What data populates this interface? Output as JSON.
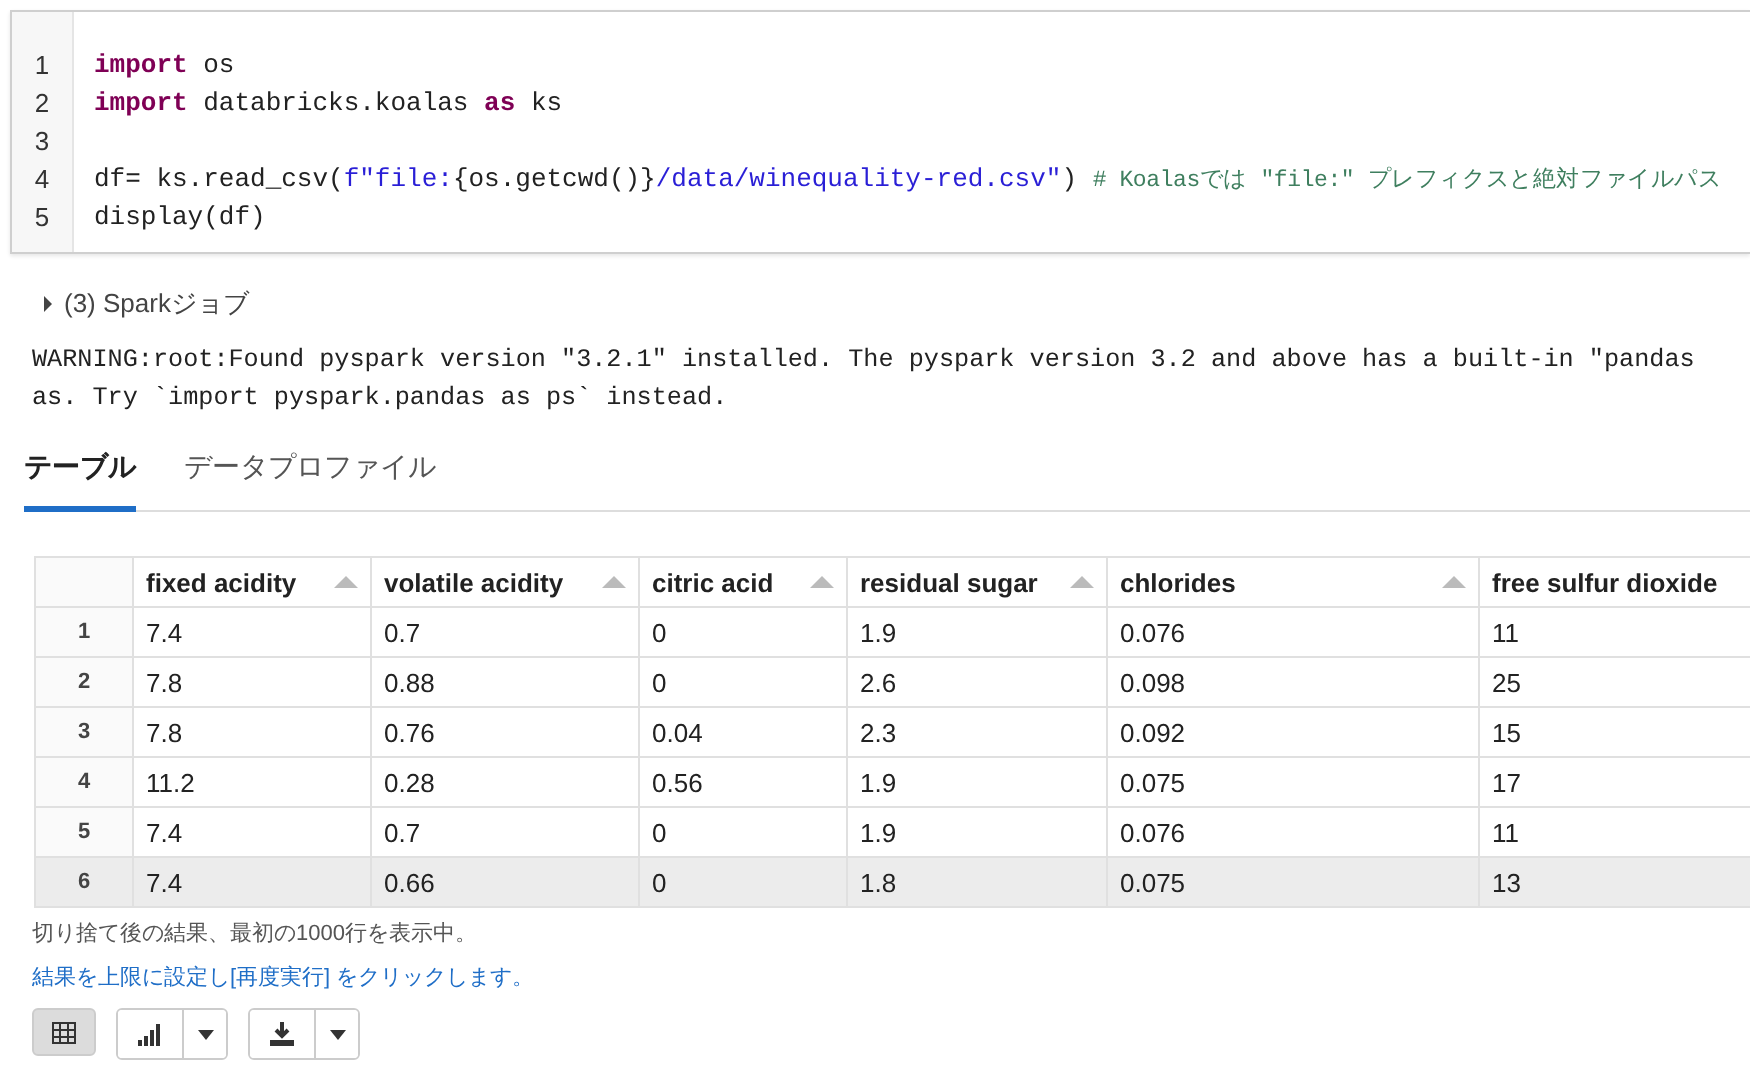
{
  "code_cell": {
    "lines": [
      {
        "number": "1",
        "tokens": [
          {
            "kind": "keyword",
            "text": "import"
          },
          {
            "kind": "plain",
            "text": " os"
          }
        ]
      },
      {
        "number": "2",
        "tokens": [
          {
            "kind": "keyword",
            "text": "import"
          },
          {
            "kind": "plain",
            "text": " databricks.koalas "
          },
          {
            "kind": "keyword",
            "text": "as"
          },
          {
            "kind": "plain",
            "text": " ks"
          }
        ]
      },
      {
        "number": "3"
      },
      {
        "number": "4",
        "tokens": [
          {
            "kind": "plain",
            "text": "df= ks.read_csv("
          },
          {
            "kind": "string",
            "text": "f\"file:"
          },
          {
            "kind": "plain",
            "text": "{os.getcwd()}"
          },
          {
            "kind": "string",
            "text": "/data/winequality-red.csv\""
          },
          {
            "kind": "plain",
            "text": ") "
          },
          {
            "kind": "comment",
            "text": "# Koalasでは \"file:\" プレフィクスと絶対ファイルパス"
          }
        ]
      },
      {
        "number": "5",
        "tokens": [
          {
            "kind": "plain",
            "text": "display(df)"
          }
        ]
      }
    ]
  },
  "spark_jobs": {
    "label": "(3) Sparkジョブ",
    "expanded": false
  },
  "warning_lines": [
    "WARNING:root:Found pyspark version \"3.2.1\" installed. The pyspark version 3.2 and above has a built-in \"pandas",
    "as. Try `import pyspark.pandas as ps` instead."
  ],
  "tabs": [
    {
      "label": "テーブル",
      "selected": true
    },
    {
      "label": "データプロファイル",
      "selected": false
    }
  ],
  "table": {
    "columns": [
      {
        "label": "fixed acidity",
        "sortable": true
      },
      {
        "label": "volatile acidity",
        "sortable": true
      },
      {
        "label": "citric acid",
        "sortable": true
      },
      {
        "label": "residual sugar",
        "sortable": true
      },
      {
        "label": "chlorides",
        "sortable": true
      },
      {
        "label": "free sulfur dioxide"
      }
    ],
    "rows": [
      {
        "index": "1",
        "highlighted": false,
        "cells": [
          "7.4",
          "0.7",
          "0",
          "1.9",
          "0.076",
          "11"
        ]
      },
      {
        "index": "2",
        "highlighted": false,
        "cells": [
          "7.8",
          "0.88",
          "0",
          "2.6",
          "0.098",
          "25"
        ]
      },
      {
        "index": "3",
        "highlighted": false,
        "cells": [
          "7.8",
          "0.76",
          "0.04",
          "2.3",
          "0.092",
          "15"
        ]
      },
      {
        "index": "4",
        "highlighted": false,
        "cells": [
          "11.2",
          "0.28",
          "0.56",
          "1.9",
          "0.075",
          "17"
        ]
      },
      {
        "index": "5",
        "highlighted": false,
        "cells": [
          "7.4",
          "0.7",
          "0",
          "1.9",
          "0.076",
          "11"
        ]
      },
      {
        "index": "6",
        "highlighted": true,
        "cells": [
          "7.4",
          "0.66",
          "0",
          "1.8",
          "0.075",
          "13"
        ]
      }
    ]
  },
  "truncation_note": "切り捨て後の結果、最初の1000行を表示中。",
  "rerun_link": "結果を上限に設定し[再度実行] をクリックします。",
  "toolbar": {
    "buttons": [
      {
        "kind": "table",
        "selected": true
      },
      {
        "kind": "chart",
        "selected": false
      },
      {
        "kind": "download",
        "selected": false
      }
    ]
  }
}
